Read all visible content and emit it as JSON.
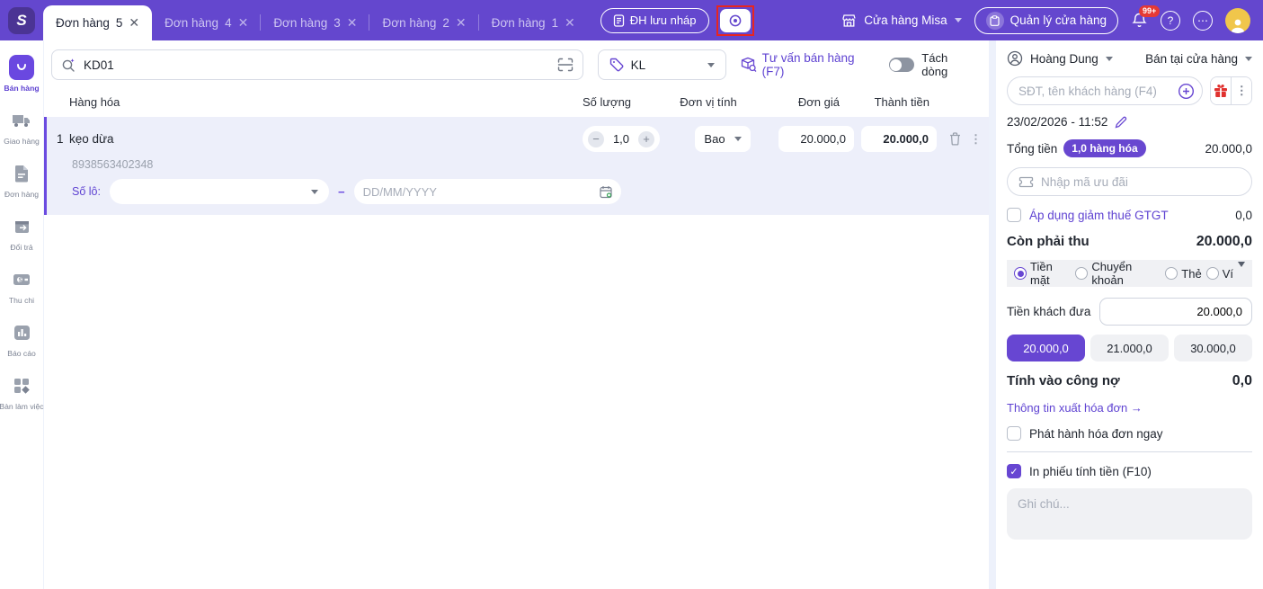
{
  "topbar": {
    "tabs": [
      {
        "name": "Đơn hàng",
        "num": "5",
        "active": true
      },
      {
        "name": "Đơn hàng",
        "num": "4",
        "active": false
      },
      {
        "name": "Đơn hàng",
        "num": "3",
        "active": false
      },
      {
        "name": "Đơn hàng",
        "num": "2",
        "active": false
      },
      {
        "name": "Đơn hàng",
        "num": "1",
        "active": false
      }
    ],
    "close_glyph": "✕",
    "draft_button": "ĐH lưu nháp",
    "store_name": "Cửa hàng Misa",
    "manage_store_button": "Quản lý cửa hàng",
    "notification_badge": "99+",
    "help_glyph": "?",
    "more_glyph": "⋯"
  },
  "sidebar": {
    "items": [
      {
        "label": "Bán hàng",
        "active": true
      },
      {
        "label": "Giao hàng",
        "active": false
      },
      {
        "label": "Đơn hàng",
        "active": false
      },
      {
        "label": "Đổi trả",
        "active": false
      },
      {
        "label": "Thu chi",
        "active": false
      },
      {
        "label": "Báo cáo",
        "active": false
      },
      {
        "label": "Bàn làm việc",
        "active": false
      }
    ]
  },
  "toolbar": {
    "search_value": "KD01",
    "price_list": "KL",
    "consult_link": "Tư vấn bán hàng (F7)",
    "split_line_label": "Tách dòng"
  },
  "table": {
    "columns": [
      "Hàng hóa",
      "Số lượng",
      "Đơn vị tính",
      "Đơn giá",
      "Thành tiền"
    ],
    "row": {
      "index": "1",
      "name": "kẹo dừa",
      "barcode": "8938563402348",
      "qty": "1,0",
      "minus": "−",
      "plus": "+",
      "unit": "Bao",
      "price": "20.000,0",
      "total": "20.000,0",
      "lot_label": "Số lô:",
      "lot_dash": "−",
      "expiry_placeholder": "DD/MM/YYYY"
    }
  },
  "panel": {
    "employee": "Hoàng Dung",
    "channel": "Bán tại cửa hàng",
    "customer_placeholder": "SĐT, tên khách hàng (F4)",
    "datetime": "23/02/2026 - 11:52",
    "total_label": "Tổng tiền",
    "total_badge": "1,0 hàng hóa",
    "total_value": "20.000,0",
    "voucher_placeholder": "Nhập mã ưu đãi",
    "vat_label": "Áp dụng giảm thuế GTGT",
    "vat_value": "0,0",
    "due_label": "Còn phải thu",
    "due_value": "20.000,0",
    "payment_methods": [
      {
        "label": "Tiền mặt",
        "selected": true
      },
      {
        "label": "Chuyển khoản",
        "selected": false
      },
      {
        "label": "Thẻ",
        "selected": false
      },
      {
        "label": "Ví",
        "selected": false
      }
    ],
    "cash_given_label": "Tiền khách đưa",
    "cash_given_value": "20.000,0",
    "quick_amounts": [
      {
        "value": "20.000,0",
        "selected": true
      },
      {
        "value": "21.000,0",
        "selected": false
      },
      {
        "value": "30.000,0",
        "selected": false
      }
    ],
    "debt_label": "Tính vào công nợ",
    "debt_value": "0,0",
    "invoice_info_link": "Thông tin xuất hóa đơn →",
    "issue_invoice_label": "Phát hành hóa đơn ngay",
    "print_receipt_label": "In phiếu tính tiền (F10)",
    "note_placeholder": "Ghi chú...",
    "check_glyph": "✓"
  },
  "colors": {
    "topbar": "#6447ce",
    "accent": "#6746d2",
    "row_highlight": "#edeffa",
    "annotation": "#e8251f",
    "danger_badge": "#e53935"
  }
}
